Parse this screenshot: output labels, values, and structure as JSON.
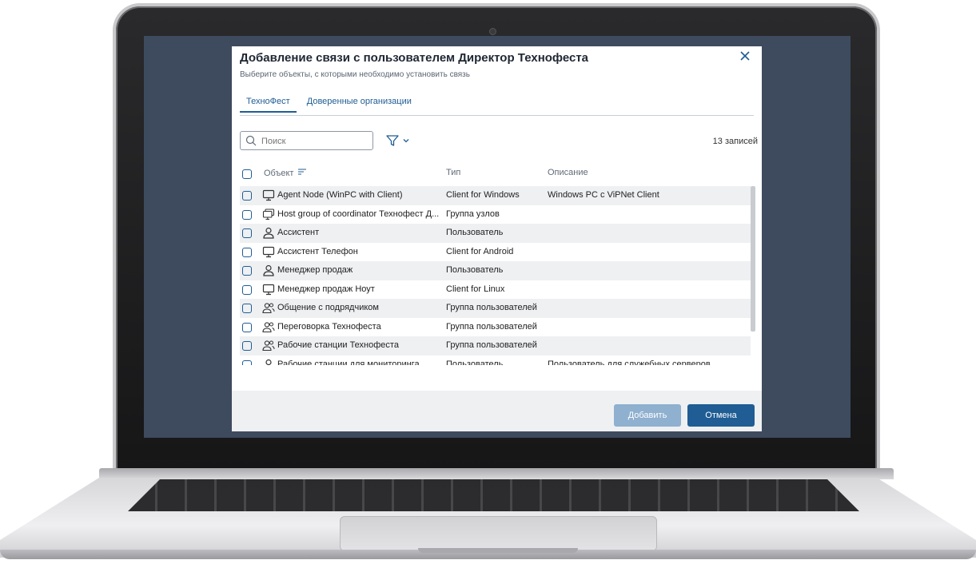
{
  "dialog": {
    "title": "Добавление связи с пользователем Директор Технофеста",
    "subtitle": "Выберите объекты, с которыми необходимо установить связь",
    "tabs": [
      {
        "label": "ТехноФест"
      },
      {
        "label": "Доверенные организации"
      }
    ],
    "search": {
      "placeholder": "Поиск",
      "value": ""
    },
    "records": "13 записей",
    "columns": {
      "object": "Объект",
      "type": "Тип",
      "description": "Описание"
    },
    "rows": [
      {
        "icon": "computer-icon",
        "name": "Agent Node (WinPC with Client)",
        "type": "Client for Windows",
        "description": "Windows PC с ViPNet Client"
      },
      {
        "icon": "host-group-icon",
        "name": "Host group of coordinator Технофест Д...",
        "type": "Группа узлов",
        "description": ""
      },
      {
        "icon": "user-icon",
        "name": "Ассистент",
        "type": "Пользователь",
        "description": ""
      },
      {
        "icon": "computer-icon",
        "name": "Ассистент Телефон",
        "type": "Client for Android",
        "description": ""
      },
      {
        "icon": "user-icon",
        "name": "Менеджер продаж",
        "type": "Пользователь",
        "description": ""
      },
      {
        "icon": "computer-icon",
        "name": "Менеджер продаж Ноут",
        "type": "Client for Linux",
        "description": ""
      },
      {
        "icon": "user-group-icon",
        "name": "Общение с подрядчиком",
        "type": "Группа пользователей",
        "description": ""
      },
      {
        "icon": "user-group-icon",
        "name": "Переговорка Технофеста",
        "type": "Группа пользователей",
        "description": ""
      },
      {
        "icon": "user-group-icon",
        "name": "Рабочие станции Технофеста",
        "type": "Группа пользователей",
        "description": ""
      },
      {
        "icon": "user-icon",
        "name": "Рабочие станции для мониторинга",
        "type": "Пользователь",
        "description": "Пользователь для служебных серверов"
      }
    ],
    "buttons": {
      "add": "Добавить",
      "cancel": "Отмена"
    }
  },
  "colors": {
    "accent": "#1f5d94",
    "accent_disabled": "#8fb0cf",
    "screen_bg": "#3e4b5e",
    "row_alt": "#eef0f2"
  }
}
